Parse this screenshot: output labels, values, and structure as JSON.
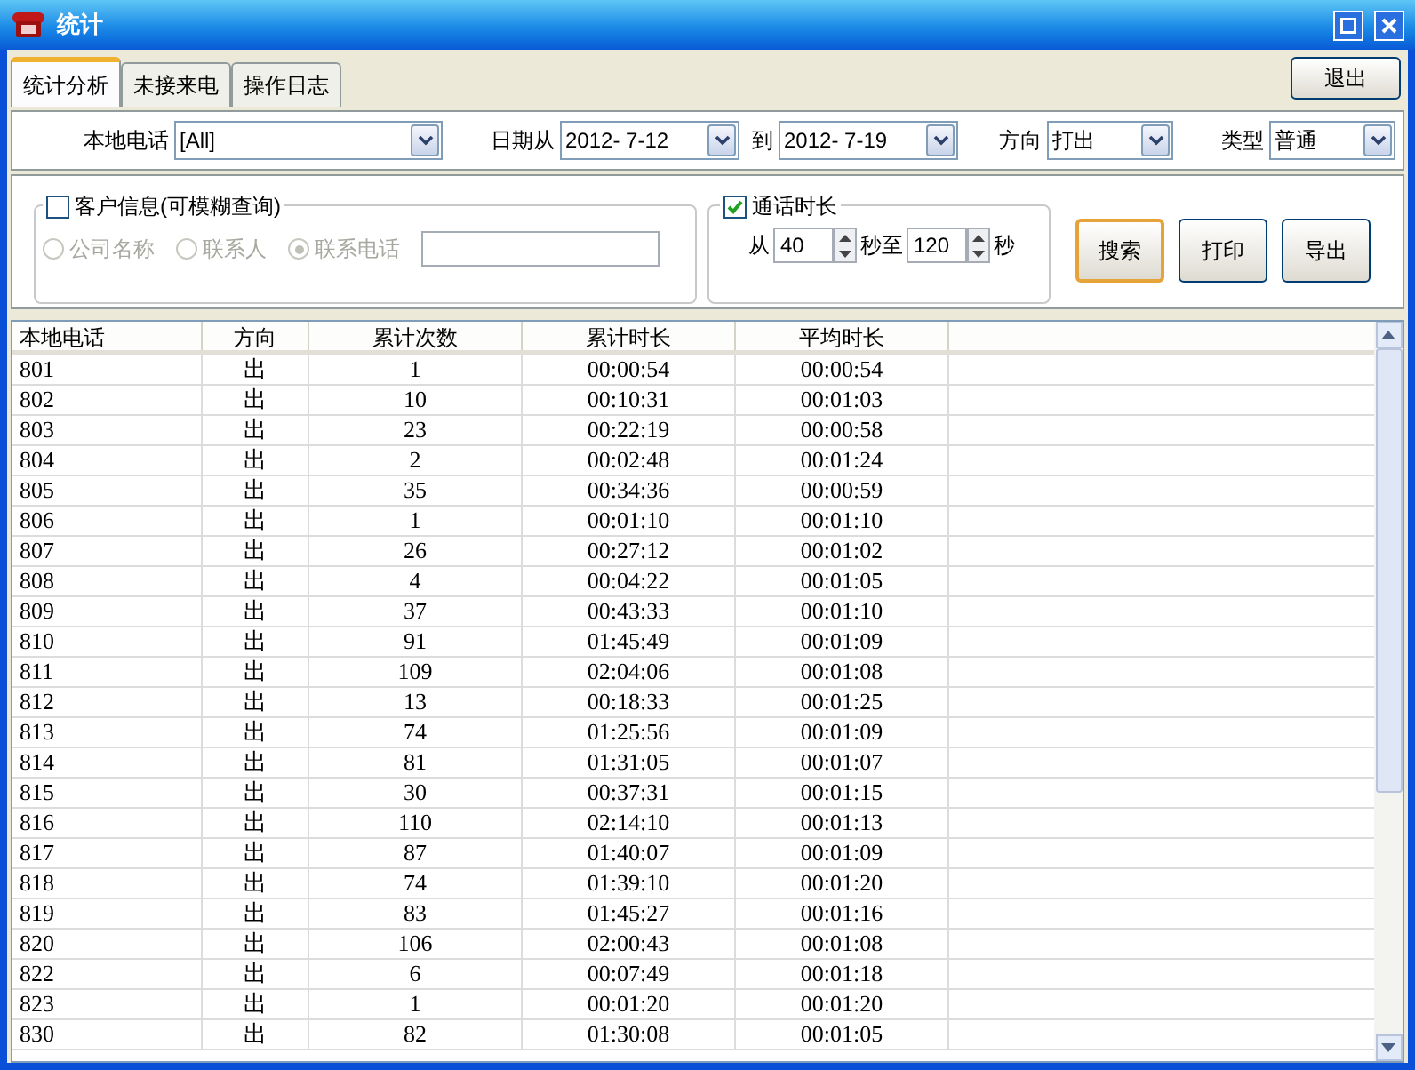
{
  "window": {
    "title": "统计"
  },
  "tabs": [
    {
      "label": "统计分析",
      "selected": true
    },
    {
      "label": "未接来电",
      "selected": false
    },
    {
      "label": "操作日志",
      "selected": false
    }
  ],
  "exit_button": "退出",
  "filters": [
    {
      "label": "本地电话",
      "value": "[All]",
      "kind": "wide"
    },
    {
      "label": "日期从",
      "value": "2012- 7-12",
      "kind": "date"
    },
    {
      "label": "到",
      "value": "2012- 7-19",
      "kind": "date"
    },
    {
      "label": "方向",
      "value": "打出",
      "kind": "short"
    },
    {
      "label": "类型",
      "value": "普通",
      "kind": "short"
    }
  ],
  "customer_info": {
    "label": "客户信息(可模糊查询)",
    "checked": false,
    "disabled": true,
    "options": [
      {
        "label": "公司名称",
        "selected": false
      },
      {
        "label": "联系人",
        "selected": false
      },
      {
        "label": "联系电话",
        "selected": true
      }
    ]
  },
  "call_duration": {
    "label": "通话时长",
    "checked": true,
    "from_label": "从",
    "from_value": "40",
    "to_label": "秒至",
    "to_value": "120",
    "unit": "秒"
  },
  "buttons": [
    {
      "label": "搜索",
      "focused": true
    },
    {
      "label": "打印",
      "focused": false
    },
    {
      "label": "导出",
      "focused": false
    }
  ],
  "table": {
    "columns": [
      "本地电话",
      "方向",
      "累计次数",
      "累计时长",
      "平均时长"
    ],
    "rows": [
      [
        "801",
        "出",
        "1",
        "00:00:54",
        "00:00:54"
      ],
      [
        "802",
        "出",
        "10",
        "00:10:31",
        "00:01:03"
      ],
      [
        "803",
        "出",
        "23",
        "00:22:19",
        "00:00:58"
      ],
      [
        "804",
        "出",
        "2",
        "00:02:48",
        "00:01:24"
      ],
      [
        "805",
        "出",
        "35",
        "00:34:36",
        "00:00:59"
      ],
      [
        "806",
        "出",
        "1",
        "00:01:10",
        "00:01:10"
      ],
      [
        "807",
        "出",
        "26",
        "00:27:12",
        "00:01:02"
      ],
      [
        "808",
        "出",
        "4",
        "00:04:22",
        "00:01:05"
      ],
      [
        "809",
        "出",
        "37",
        "00:43:33",
        "00:01:10"
      ],
      [
        "810",
        "出",
        "91",
        "01:45:49",
        "00:01:09"
      ],
      [
        "811",
        "出",
        "109",
        "02:04:06",
        "00:01:08"
      ],
      [
        "812",
        "出",
        "13",
        "00:18:33",
        "00:01:25"
      ],
      [
        "813",
        "出",
        "74",
        "01:25:56",
        "00:01:09"
      ],
      [
        "814",
        "出",
        "81",
        "01:31:05",
        "00:01:07"
      ],
      [
        "815",
        "出",
        "30",
        "00:37:31",
        "00:01:15"
      ],
      [
        "816",
        "出",
        "110",
        "02:14:10",
        "00:01:13"
      ],
      [
        "817",
        "出",
        "87",
        "01:40:07",
        "00:01:09"
      ],
      [
        "818",
        "出",
        "74",
        "01:39:10",
        "00:01:20"
      ],
      [
        "819",
        "出",
        "83",
        "01:45:27",
        "00:01:16"
      ],
      [
        "820",
        "出",
        "106",
        "02:00:43",
        "00:01:08"
      ],
      [
        "822",
        "出",
        "6",
        "00:07:49",
        "00:01:18"
      ],
      [
        "823",
        "出",
        "1",
        "00:01:20",
        "00:01:20"
      ],
      [
        "830",
        "出",
        "82",
        "01:30:08",
        "00:01:05"
      ]
    ]
  }
}
